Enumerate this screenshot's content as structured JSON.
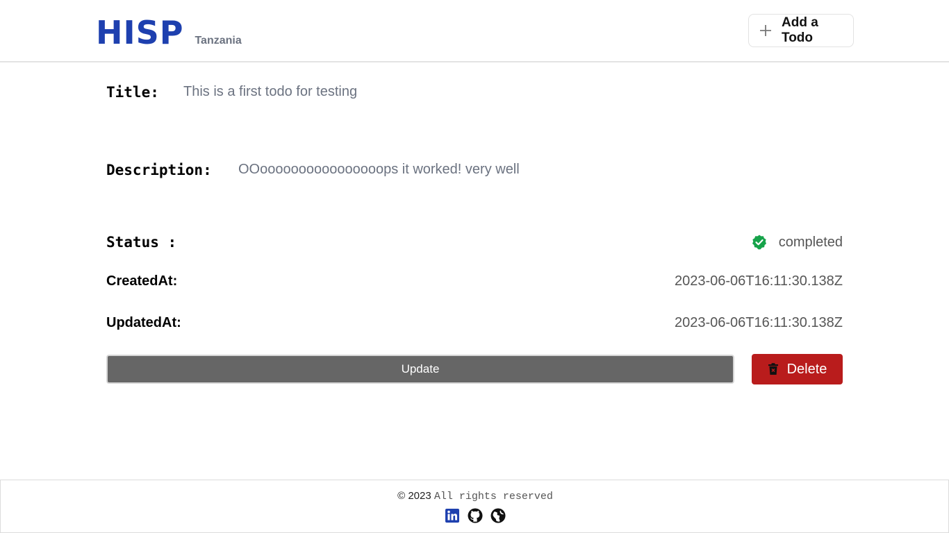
{
  "header": {
    "brand": "HISP",
    "subtitle": "Tanzania",
    "add_button_label": "Add a Todo"
  },
  "todo": {
    "title_label": "Title:",
    "title_value": "This is a first todo for testing",
    "description_label": "Description:",
    "description_value": "OOoooooooooooooooops it worked! very well",
    "status_label": "Status :",
    "status_value": "completed",
    "created_label": "CreatedAt:",
    "created_value": "2023-06-06T16:11:30.138Z",
    "updated_label": "UpdatedAt:",
    "updated_value": "2023-06-06T16:11:30.138Z"
  },
  "actions": {
    "update_label": "Update",
    "delete_label": "Delete"
  },
  "footer": {
    "copyright": "© 2023",
    "rights": "All rights reserved",
    "icons": [
      "linkedin-icon",
      "github-icon",
      "globe-icon"
    ]
  },
  "colors": {
    "brand": "#1e40af",
    "status_ok": "#16a34a",
    "update_bg": "#666666",
    "delete_bg": "#b91c1c",
    "linkedin": "#1e40af"
  }
}
